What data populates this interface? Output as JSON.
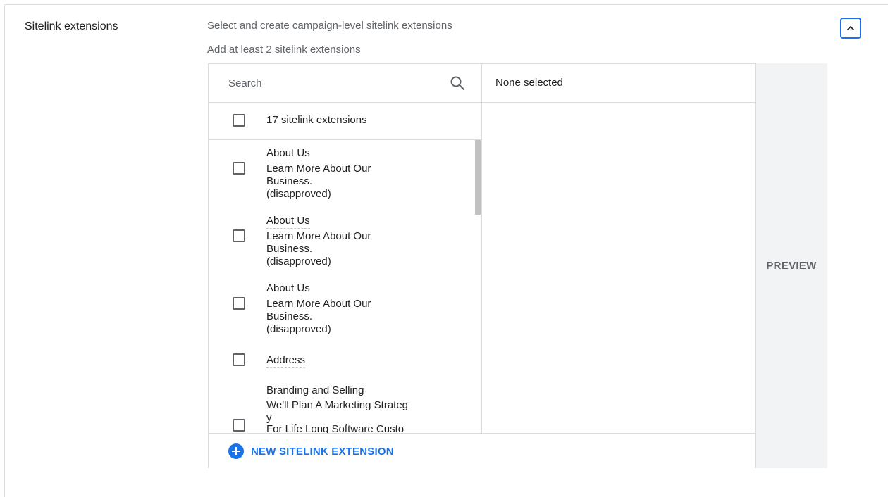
{
  "section": {
    "label": "Sitelink extensions",
    "description": "Select and create campaign-level sitelink extensions",
    "hint": "Add at least 2 sitelink extensions"
  },
  "search": {
    "placeholder": "Search",
    "value": ""
  },
  "list_header": {
    "label": "17 sitelink extensions"
  },
  "selected_panel": {
    "label": "None selected"
  },
  "items": [
    {
      "title": "About Us",
      "lines": [
        "Learn More About Our",
        "Business.",
        "(disapproved)"
      ]
    },
    {
      "title": "About Us",
      "lines": [
        "Learn More About Our",
        "Business.",
        "(disapproved)"
      ]
    },
    {
      "title": "About Us",
      "lines": [
        "Learn More About Our",
        "Business.",
        "(disapproved)"
      ]
    },
    {
      "title": "Address",
      "lines": []
    },
    {
      "title": "Branding and Selling",
      "lines": [
        "We'll Plan A Marketing Strateg",
        "y",
        "For Life Long Software Custo"
      ]
    }
  ],
  "footer": {
    "new_label": "NEW SITELINK EXTENSION"
  },
  "preview": {
    "label": "PREVIEW"
  },
  "icons": {
    "search": "search-icon",
    "collapse": "chevron-up-icon",
    "add": "plus-circle-icon"
  },
  "colors": {
    "accent": "#1a73e8",
    "preview_bg": "#f1f3f4"
  }
}
